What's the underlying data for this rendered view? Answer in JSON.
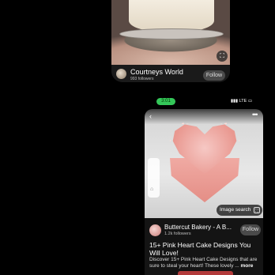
{
  "top_card": {
    "name": "Courtneys World",
    "followers": "993 followers",
    "follow_label": "Follow",
    "lens_icon": "lens-icon"
  },
  "status": {
    "time": "3:01",
    "network": "LTE"
  },
  "bottom_card": {
    "back_icon": "chevron-left-icon",
    "more_icon": "more-icon",
    "image_search_label": "Image search",
    "profile_name": "Buttercut Bakery - A B...",
    "followers": "1.2k followers",
    "follow_label": "Follow",
    "title": "15+ Pink Heart Cake Designs You Will Love!",
    "description": "Discover 15+ Pink Heart Cake Designs that are sure to steal your heart! These lovely ...",
    "more_label": "more"
  },
  "colors": {
    "status_pill": "#34c759",
    "pink": "#e99890"
  }
}
